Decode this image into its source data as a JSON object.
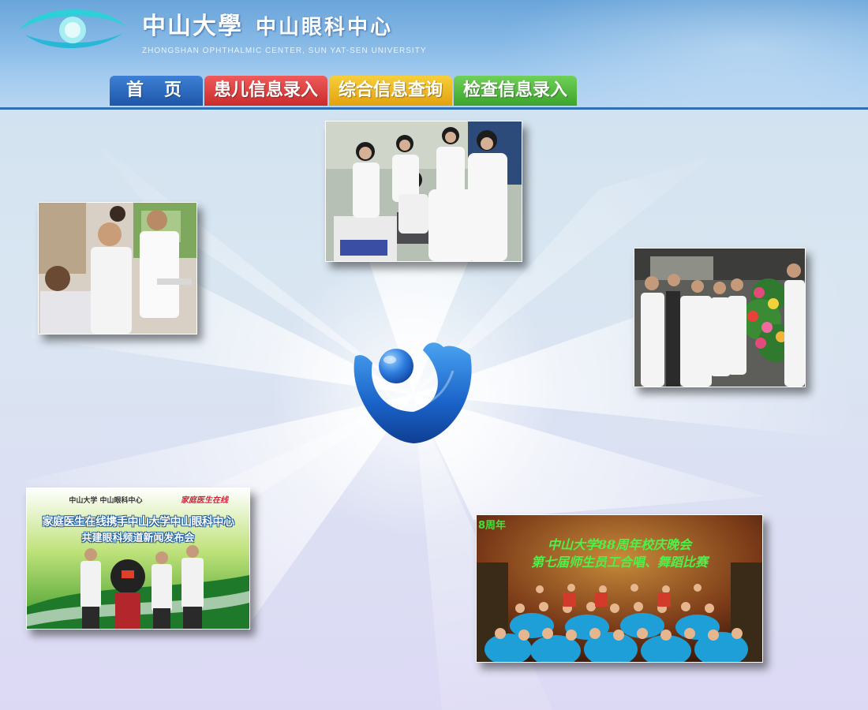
{
  "header": {
    "title_cn_main": "中山大學",
    "title_cn_sub": "中山眼科中心",
    "title_en": "ZHONGSHAN OPHTHALMIC CENTER, SUN YAT-SEN UNIVERSITY"
  },
  "nav": {
    "home": "首页",
    "patient_entry": "患儿信息录入",
    "query": "综合信息查询",
    "exam_entry": "检查信息录入"
  },
  "colors": {
    "nav_home": "#2a68c0",
    "nav_patient": "#dc3e3e",
    "nav_query": "#eeb824",
    "nav_exam": "#52bb3f",
    "header_line": "#2f6fb4"
  },
  "photos": {
    "doctor_patient": {},
    "lab_team": {},
    "reception": {},
    "press_launch": {
      "banner_top_left": "中山大学 中山眼科中心",
      "banner_top_right": "家庭医生在线",
      "headline_1": "家庭医生在线携手中山大学中山眼科中心",
      "headline_2": "共建眼科频道新闻发布会"
    },
    "anniversary_show": {
      "corner": "8周年",
      "headline_1": "中山大学88周年校庆晚会",
      "headline_2": "第七届师生员工合唱、舞蹈比赛"
    }
  }
}
